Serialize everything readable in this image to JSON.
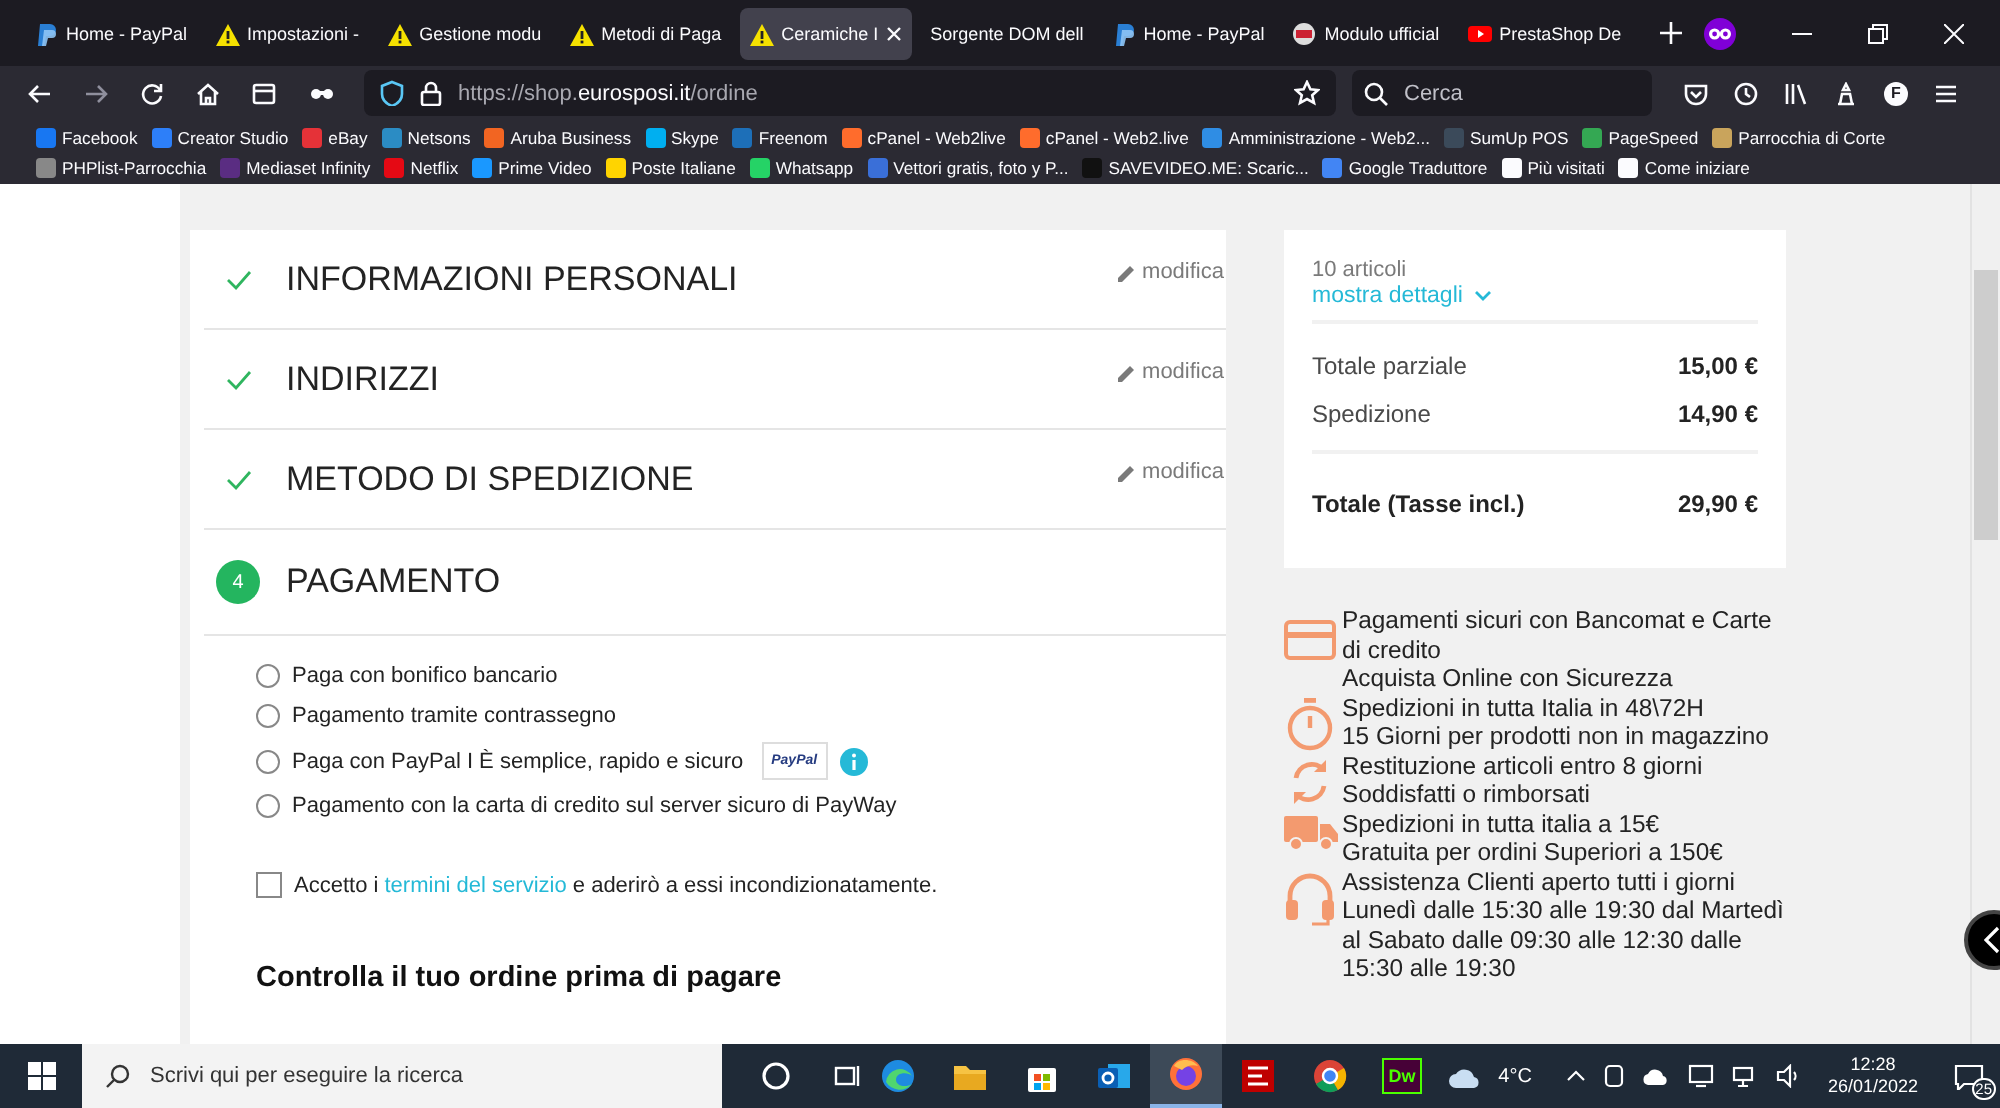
{
  "browser": {
    "tabs": [
      {
        "label": "Home - PayPal",
        "kind": "paypal",
        "selected": false
      },
      {
        "label": "Impostazioni -",
        "kind": "warning",
        "selected": false
      },
      {
        "label": "Gestione modu",
        "kind": "warning",
        "selected": false
      },
      {
        "label": "Metodi di Paga",
        "kind": "warning",
        "selected": false
      },
      {
        "label": "Ceramiche I",
        "kind": "warning",
        "selected": true
      },
      {
        "label": "Sorgente DOM dell",
        "kind": "plain",
        "selected": false
      },
      {
        "label": "Home - PayPal",
        "kind": "paypal",
        "selected": false
      },
      {
        "label": "Modulo ufficial",
        "kind": "globe",
        "selected": false
      },
      {
        "label": "PrestaShop De",
        "kind": "video",
        "selected": false
      }
    ],
    "address": "https://shop.**eurosposi.it**/ordine",
    "search_placeholder": "Cerca",
    "account_initial": "F",
    "bookmark_rows": [
      [
        {
          "label": "Facebook",
          "color": "#1877f2"
        },
        {
          "label": "Creator Studio",
          "color": "#2d7ff9"
        },
        {
          "label": "eBay",
          "color": "#e53238"
        },
        {
          "label": "Netsons",
          "color": "#2b8cc4"
        },
        {
          "label": "Aruba Business",
          "color": "#f26522"
        },
        {
          "label": "Skype",
          "color": "#00aff0"
        },
        {
          "label": "Freenom",
          "color": "#1d6fb8"
        },
        {
          "label": "cPanel - Web2live",
          "color": "#ff6c2c"
        },
        {
          "label": "cPanel - Web2.live",
          "color": "#ff6c2c"
        },
        {
          "label": "Amministrazione - Web2...",
          "color": "#2f8de4"
        },
        {
          "label": "SumUp POS",
          "color": "#3b4a5a"
        },
        {
          "label": "PageSpeed",
          "color": "#34a853"
        },
        {
          "label": "Parrocchia di Corte",
          "color": "#c9a45c"
        }
      ],
      [
        {
          "label": "PHPlist-Parrocchia",
          "color": "#888888"
        },
        {
          "label": "Mediaset Infinity",
          "color": "#5a2d82"
        },
        {
          "label": "Netflix",
          "color": "#e50914"
        },
        {
          "label": "Prime Video",
          "color": "#1a98ff"
        },
        {
          "label": "Poste Italiane",
          "color": "#ffd400"
        },
        {
          "label": "Whatsapp",
          "color": "#25d366"
        },
        {
          "label": "Vettori gratis, foto y P...",
          "color": "#3a6fd8"
        },
        {
          "label": "SAVEVIDEO.ME: Scaric...",
          "color": "#111111"
        },
        {
          "label": "Google Traduttore",
          "color": "#4285f4"
        },
        {
          "label": "Più visitati",
          "color": "#fbfbfe"
        },
        {
          "label": "Come iniziare",
          "color": "#fbfbfe"
        }
      ]
    ]
  },
  "checkout": {
    "steps": [
      {
        "title": "INFORMAZIONI PERSONALI",
        "done": true,
        "edit": "modifica"
      },
      {
        "title": "INDIRIZZI",
        "done": true,
        "edit": "modifica"
      },
      {
        "title": "METODO DI SPEDIZIONE",
        "done": true,
        "edit": "modifica"
      },
      {
        "title": "PAGAMENTO",
        "done": false,
        "number": "4"
      }
    ],
    "payment_options": [
      {
        "label": "Paga con bonifico bancario",
        "selected": false
      },
      {
        "label": "Pagamento tramite contrassegno",
        "selected": false
      },
      {
        "label": "Paga con PayPal I È semplice, rapido e sicuro",
        "selected": false,
        "logo": "PayPal",
        "info": true
      },
      {
        "label": "Pagamento con la carta di credito sul server sicuro di PayWay",
        "selected": false
      }
    ],
    "terms": {
      "checked": false,
      "before": "Accetto i ",
      "link": "termini del servizio",
      "after": " e aderirò a essi incondizionatamente."
    },
    "review_heading": "Controlla il tuo ordine prima di pagare"
  },
  "summary": {
    "count": "10 articoli",
    "details_link": "mostra dettagli",
    "lines": [
      {
        "label": "Totale parziale",
        "value": "15,00 €"
      },
      {
        "label": "Spedizione",
        "value": "14,90 €"
      }
    ],
    "total": {
      "label": "Totale (Tasse incl.)",
      "value": "29,90 €"
    }
  },
  "reassurance": [
    {
      "kind": "card",
      "title": "Pagamenti sicuri con Bancomat e Carte di credito",
      "text": "Acquista Online con Sicurezza"
    },
    {
      "kind": "timer",
      "title": "Spedizioni in tutta Italia in 48\\72H",
      "text": "15 Giorni per prodotti non in magazzino"
    },
    {
      "kind": "return",
      "title": "Restituzione articoli entro 8 giorni",
      "text": "Soddisfatti o rimborsati"
    },
    {
      "kind": "truck",
      "title": "Spedizioni in tutta italia a 15€",
      "text": "Gratuita per ordini Superiori a 150€"
    },
    {
      "kind": "headset",
      "title": "Assistenza Clienti aperto tutti i giorni",
      "text": "Lunedì dalle 15:30 alle 19:30 dal Martedì al Sabato dalle 09:30 alle 12:30 dalle 15:30 alle 19:30"
    }
  ],
  "taskbar": {
    "search_placeholder": "Scrivi qui per eseguire la ricerca",
    "apps": [
      {
        "kind": "edge",
        "active": false
      },
      {
        "kind": "explorer",
        "active": false
      },
      {
        "kind": "store",
        "active": false
      },
      {
        "kind": "outlook",
        "active": false
      },
      {
        "kind": "firefox",
        "active": true
      },
      {
        "kind": "filezilla",
        "active": false
      },
      {
        "kind": "chrome",
        "active": false
      },
      {
        "kind": "dreamweaver",
        "label": "Dw",
        "active": false
      }
    ],
    "temperature": "4°C",
    "time": "12:28",
    "date": "26/01/2022",
    "notifications": "25"
  }
}
